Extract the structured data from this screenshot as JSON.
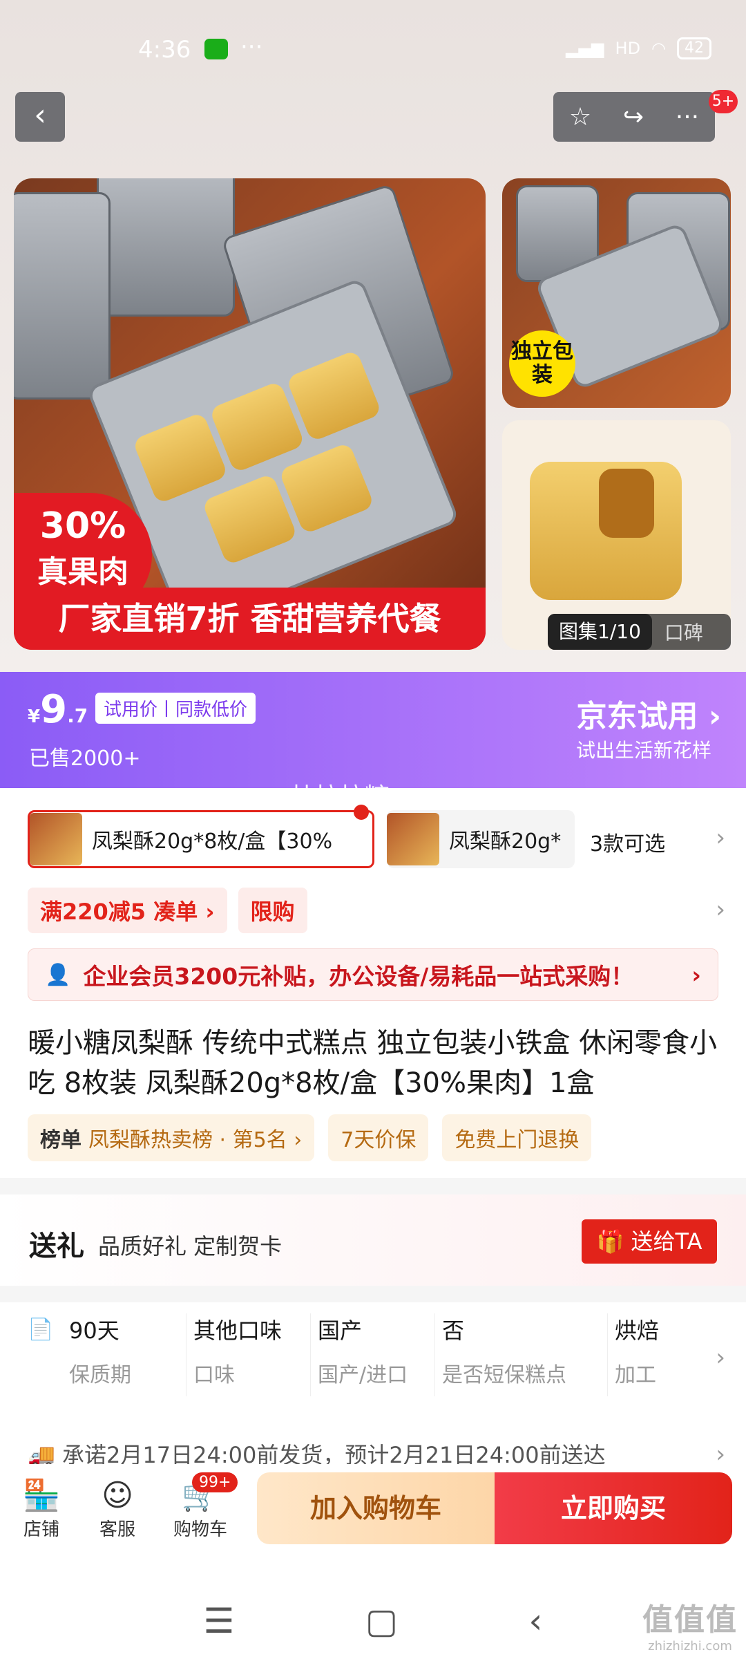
{
  "status_bar": {
    "time": "4:36",
    "dots": "···",
    "network": "HD",
    "battery": "42"
  },
  "nav": {
    "back_glyph": "‹",
    "favorite_glyph": "☆",
    "share_glyph": "↪",
    "more_glyph": "···",
    "badge": "5+"
  },
  "gallery": {
    "main_badge_percent": "30%",
    "main_badge_text": "真果肉",
    "main_banner": "厂家直销7折 香甜营养代餐",
    "side_badge": "独立包装",
    "tab_active": "图集1/10",
    "tab_other": "口碑"
  },
  "trial": {
    "currency": "¥",
    "price_int": "9",
    "price_dec": ".7",
    "price_tag": "试用价丨同款低价",
    "sold": "已售2000+",
    "title": "京东试用",
    "subtitle": "试出生活新花样"
  },
  "overlay_text": "杜拉拉糖",
  "variants": {
    "option1": "凤梨酥20g*8枚/盒【30%",
    "option2": "凤梨酥20g*",
    "more": "3款可选",
    "arrow": "›"
  },
  "promotions": {
    "tag1": "满220减5  凑单 ›",
    "tag2": "限购",
    "arrow": "›"
  },
  "enterprise": {
    "icon": "👤",
    "text": "企业会员3200元补贴，办公设备/易耗品一站式采购！",
    "arrow": "›"
  },
  "product_title": "暖小糖凤梨酥 传统中式糕点 独立包装小铁盒 休闲零食小吃 8枚装 凤梨酥20g*8枚/盒【30%果肉】1盒",
  "tags": {
    "rank_label": "榜单",
    "rank_text": "凤梨酥热卖榜 · 第5名 ›",
    "tag2": "7天价保",
    "tag3": "免费上门退换"
  },
  "gift": {
    "title": "送礼",
    "subtitle": "品质好礼  定制贺卡",
    "button": "送给TA",
    "button_icon": "🎁"
  },
  "specs": [
    {
      "value": "90天",
      "key": "保质期"
    },
    {
      "value": "其他口味",
      "key": "口味"
    },
    {
      "value": "国产",
      "key": "国产/进口"
    },
    {
      "value": "否",
      "key": "是否短保糕点"
    },
    {
      "value": "烘焙",
      "key": "加工"
    }
  ],
  "specs_icon": "📄",
  "specs_arrow": "›",
  "shipping": {
    "icon": "🚚",
    "text": "承诺2月17日24:00前发货，预计2月21日24:00前送达",
    "arrow": "›"
  },
  "bottom_bar": {
    "shop_icon": "🏪",
    "shop": "店铺",
    "service_icon": "☺",
    "service": "客服",
    "cart_icon": "🛒",
    "cart": "购物车",
    "cart_badge": "99+",
    "add_cart": "加入购物车",
    "buy_now": "立即购买"
  },
  "system_nav": {
    "menu": "☰",
    "home": "▢",
    "back": "‹"
  },
  "watermark": {
    "big": "值值值",
    "small": "zhizhizhi.com"
  }
}
